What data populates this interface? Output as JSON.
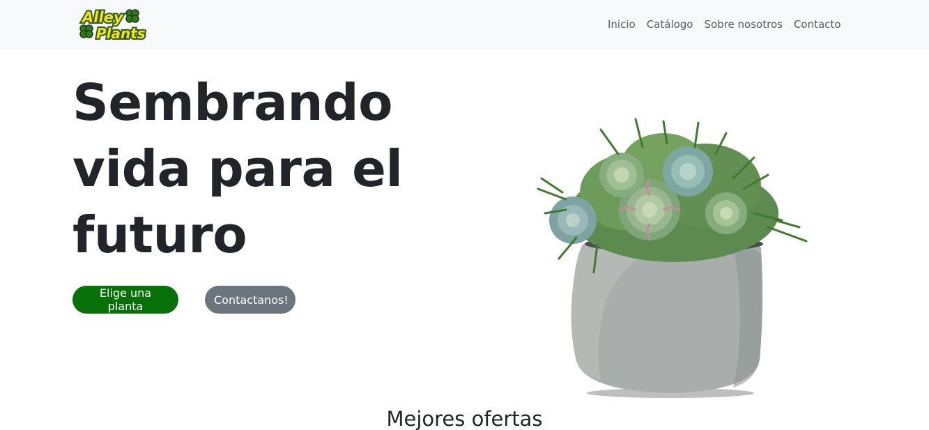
{
  "brand": {
    "name_line1": "Alley",
    "name_line2": "Plants",
    "icon": "clover-icon"
  },
  "nav": {
    "links": [
      "Inicio",
      "Catálogo",
      "Sobre nosotros",
      "Contacto"
    ]
  },
  "hero": {
    "title_lines": [
      "Sembrando",
      "vida para el",
      "futuro"
    ],
    "primary_button": "Elige una planta",
    "secondary_button": "Contactanos!",
    "image": "succulent-pot-image"
  },
  "offers": {
    "title": "Mejores ofertas"
  },
  "colors": {
    "navbar_bg": "#f8f9fa",
    "primary": "#087008",
    "secondary": "#6c757d",
    "logo_yellow": "#f2e318",
    "logo_green": "#2f5a1c"
  }
}
